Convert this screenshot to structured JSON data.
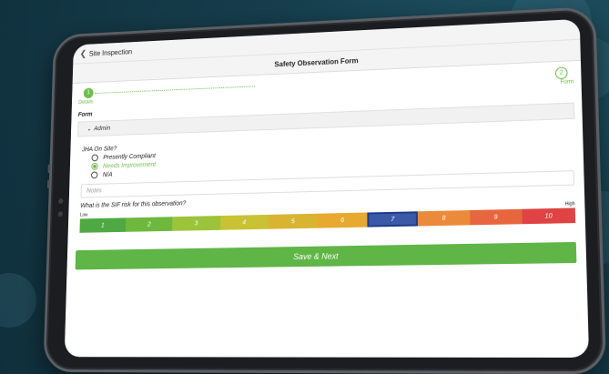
{
  "header": {
    "back_label": "Site Inspection",
    "title": "Safety Observation Form"
  },
  "stepper": {
    "steps": [
      {
        "number": "1",
        "label": "Details",
        "state": "complete"
      },
      {
        "number": "2",
        "label": "Form",
        "state": "pending"
      }
    ]
  },
  "form": {
    "section_title": "Form",
    "accordion_label": "Admin",
    "jha": {
      "label": "JHA On Site?",
      "options": [
        "Presently Compliant",
        "Needs Improvement",
        "N/A"
      ],
      "selected": "Needs Improvement"
    },
    "notes_placeholder": "Notes",
    "sif": {
      "question": "What is the SIF risk for this observation?",
      "low_label": "Low",
      "high_label": "High",
      "values": [
        "1",
        "2",
        "3",
        "4",
        "5",
        "6",
        "7",
        "8",
        "9",
        "10"
      ],
      "selected": "7",
      "colors": [
        "#4fa943",
        "#6fb83e",
        "#9cc33a",
        "#c9c235",
        "#d9b431",
        "#e7a92f",
        "#3a5aa8",
        "#ec8a3b",
        "#e7663f",
        "#df4343"
      ]
    },
    "save_label": "Save & Next"
  },
  "colors": {
    "accent": "#6cbf4a",
    "button": "#5fb546"
  }
}
